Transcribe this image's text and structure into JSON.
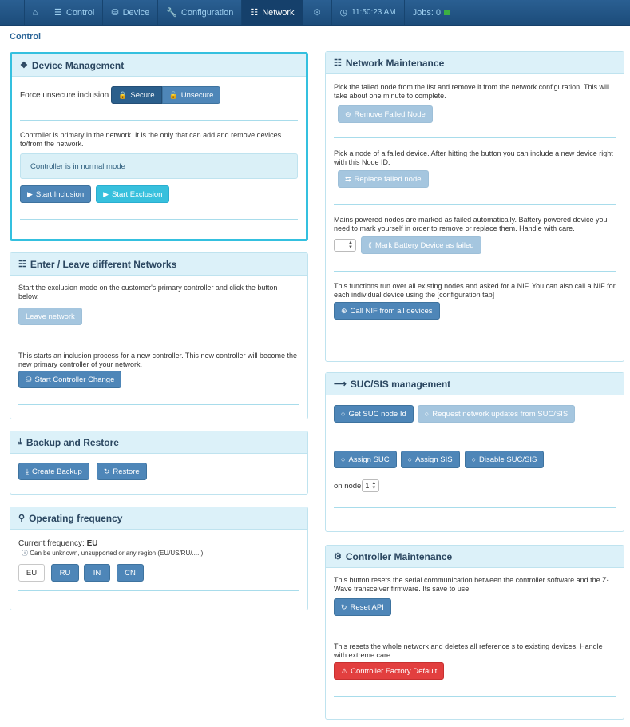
{
  "nav": {
    "control": "Control",
    "device": "Device",
    "configuration": "Configuration",
    "network": "Network",
    "clock": "11:50:23 AM",
    "jobs": "Jobs: 0"
  },
  "page_title": "Control",
  "device_mgmt": {
    "title": "Device Management",
    "force_label": "Force unsecure inclusion",
    "secure": "Secure",
    "unsecure": "Unsecure",
    "primary_text": "Controller is primary in the network. It is the only that can add and remove devices to/from the network.",
    "mode_alert": "Controller is in normal mode",
    "start_inclusion": "Start Inclusion",
    "start_exclusion": "Start Exclusion"
  },
  "networks": {
    "title": "Enter / Leave different Networks",
    "exclusion_text": "Start the exclusion mode on the customer's primary controller and click the button below.",
    "leave": "Leave network",
    "inclusion_text": "This starts an inclusion process for a new controller. This new controller will become the new primary controller of your network.",
    "start_change": "Start Controller Change"
  },
  "backup": {
    "title": "Backup and Restore",
    "create": "Create Backup",
    "restore": "Restore"
  },
  "frequency": {
    "title": "Operating frequency",
    "current_label": "Current frequency:",
    "current_value": "EU",
    "note": "Can be unknown, unsupported or any region (EU/US/RU/.....)",
    "options": [
      "EU",
      "RU",
      "IN",
      "CN"
    ]
  },
  "net_maint": {
    "title": "Network Maintenance",
    "remove_text": "Pick the failed node from the list and remove it from the network configuration. This will take about one minute to complete.",
    "remove_btn": "Remove Failed Node",
    "replace_text": "Pick a node of a failed device. After hitting the button you can include a new device right with this Node ID.",
    "replace_btn": "Replace failed node",
    "battery_text": "Mains powered nodes are marked as failed automatically. Battery powered device you need to mark yourself in order to remove or replace them. Handle with care.",
    "mark_btn": "Mark Battery Device as failed",
    "nif_text": "This functions run over all existing nodes and asked for a NIF. You can also call a NIF for each individual device using the [configuration tab]",
    "nif_btn": "Call NIF from all devices"
  },
  "suc": {
    "title": "SUC/SIS management",
    "get_suc": "Get SUC node Id",
    "request_updates": "Request network updates from SUC/SIS",
    "assign_suc": "Assign SUC",
    "assign_sis": "Assign SIS",
    "disable": "Disable SUC/SIS",
    "on_node_label": "on node",
    "on_node_value": "1"
  },
  "ctrl_maint": {
    "title": "Controller Maintenance",
    "reset_text": "This button resets the serial communication between the controller software and the Z-Wave transceiver firmware. Its save to use",
    "reset_btn": "Reset API",
    "factory_text": "This resets the whole network and deletes all reference s to existing devices. Handle with extreme care.",
    "factory_btn": "Controller Factory Default"
  }
}
